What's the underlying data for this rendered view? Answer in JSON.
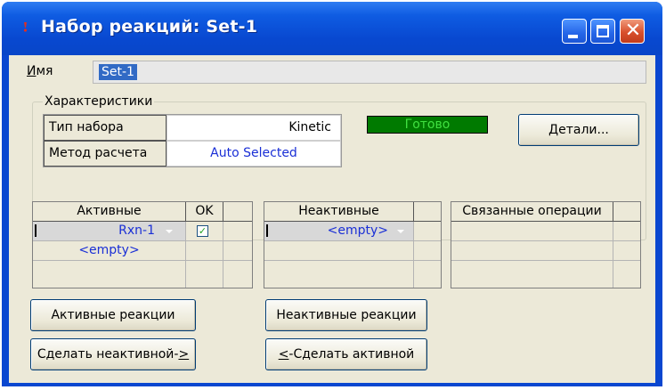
{
  "window": {
    "title": "Набор реакций: Set-1"
  },
  "name_field": {
    "label_underlined": "И",
    "label_rest": "мя",
    "value": "Set-1"
  },
  "characteristics": {
    "legend": "Характеристики",
    "rows": [
      {
        "key": "Тип набора",
        "value": "Kinetic"
      },
      {
        "key": "Метод расчета",
        "value": "Auto Selected"
      }
    ],
    "status": "Готово",
    "status_color": "#007a00",
    "details_button": {
      "underlined": "Д",
      "rest": "етали..."
    }
  },
  "active_grid": {
    "headers": [
      "Активные",
      "OK"
    ],
    "rows": [
      {
        "name": "Rxn-1",
        "ok_checked": true
      },
      {
        "name": "<empty>"
      }
    ]
  },
  "inactive_grid": {
    "headers": [
      "Неактивные"
    ],
    "rows": [
      {
        "name": "<empty>"
      }
    ]
  },
  "linked_grid": {
    "headers": [
      "Связанные операции"
    ]
  },
  "buttons": {
    "active_reactions": "Активные реакции",
    "inactive_reactions": "Неактивные реакции",
    "make_inactive_prefix": "Сделать неактивной-",
    "make_inactive_underlined": ">",
    "make_active_underlined": "<",
    "make_active_suffix": "-Сделать активной"
  },
  "colors": {
    "titlebar": "#0848d0",
    "client_bg": "#ece9d8",
    "link_blue": "#1a2fd6"
  }
}
